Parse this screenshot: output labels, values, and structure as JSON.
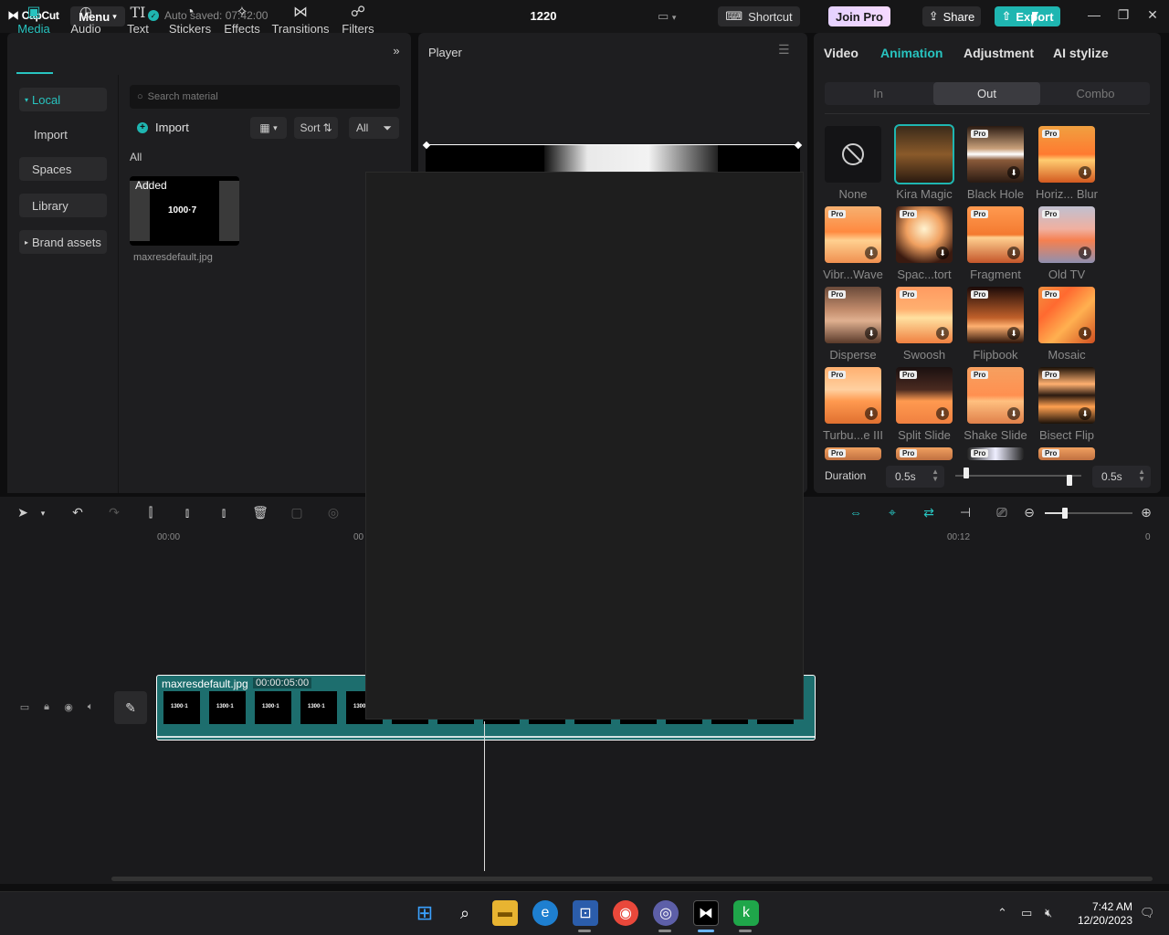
{
  "titlebar": {
    "app_name": "CapCut",
    "menu_label": "Menu",
    "autosave_text": "Auto saved: 07:42:00",
    "project_title": "1220",
    "shortcut_label": "Shortcut",
    "joinpro_label": "Join Pro",
    "share_label": "Share",
    "export_label": "Export"
  },
  "tools": [
    {
      "label": "Media",
      "icon": "media-icon"
    },
    {
      "label": "Audio",
      "icon": "audio-icon"
    },
    {
      "label": "Text",
      "icon": "text-icon"
    },
    {
      "label": "Stickers",
      "icon": "stickers-icon"
    },
    {
      "label": "Effects",
      "icon": "effects-icon"
    },
    {
      "label": "Transitions",
      "icon": "transitions-icon"
    },
    {
      "label": "Filters",
      "icon": "filters-icon"
    }
  ],
  "sidebar": {
    "items": [
      "Local",
      "Import",
      "Spaces",
      "Library",
      "Brand assets"
    ]
  },
  "media": {
    "search_placeholder": "Search material",
    "import_label": "Import",
    "sort_label": "Sort",
    "all_filter_label": "All",
    "all_section_label": "All",
    "thumb_badge": "Added",
    "thumb_text": "1000·7",
    "file_name": "maxresdefault.jpg"
  },
  "player": {
    "label": "Player"
  },
  "right_panel": {
    "tabs": [
      "Video",
      "Animation",
      "Adjustment",
      "AI stylize"
    ],
    "segments": [
      "In",
      "Out",
      "Combo"
    ],
    "pro_badge": "Pro",
    "animations": [
      "None",
      "Kira Magic",
      "Black Hole",
      "Horiz... Blur",
      "Vibr...Wave",
      "Spac...tort",
      "Fragment",
      "Old TV",
      "Disperse",
      "Swoosh",
      "Flipbook",
      "Mosaic",
      "Turbu...e III",
      "Split Slide",
      "Shake Slide",
      "Bisect Flip"
    ],
    "duration_label": "Duration",
    "duration_left": "0.5s",
    "duration_right": "0.5s"
  },
  "timeline": {
    "ruler": [
      "00:00",
      "00",
      "00:12",
      "0"
    ],
    "clip_name": "maxresdefault.jpg",
    "clip_duration": "00:00:05:00",
    "frame_text": "1300·1"
  },
  "taskbar": {
    "time": "7:42 AM",
    "date": "12/20/2023"
  },
  "colors": {
    "accent": "#1fb6b1",
    "panel": "#1e1e20",
    "background": "#0e0e0f"
  }
}
